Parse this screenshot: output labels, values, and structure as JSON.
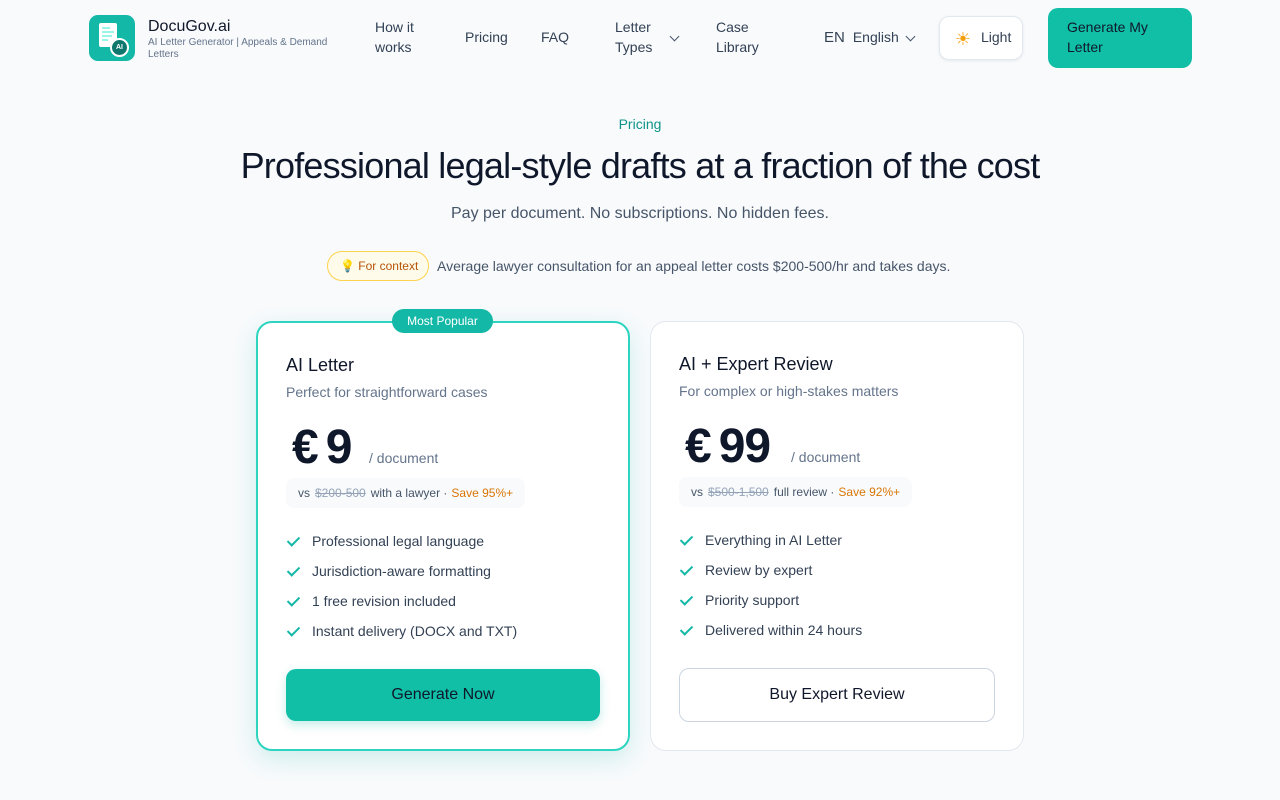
{
  "header": {
    "brand_name": "DocuGov.ai",
    "brand_tagline": "AI Letter Generator | Appeals & Demand Letters",
    "logo_badge": "AI",
    "nav": {
      "how_it_works": "How it works",
      "pricing": "Pricing",
      "faq": "FAQ",
      "letter_types": "Letter Types",
      "case_library": "Case Library"
    },
    "language": {
      "code": "EN",
      "label": "English"
    },
    "theme": {
      "icon": "sun-icon",
      "label": "Light"
    },
    "cta": "Generate My Letter"
  },
  "hero": {
    "eyebrow": "Pricing",
    "title": "Professional legal-style drafts at a fraction of the cost",
    "subtitle": "Pay per document. No subscriptions. No hidden fees.",
    "context_badge": "💡 For context",
    "context_text": "Average lawyer consultation for an appeal letter costs $200-500/hr and takes days."
  },
  "plans": [
    {
      "badge": "Most Popular",
      "name": "AI Letter",
      "description": "Perfect for straightforward cases",
      "currency": "€",
      "price": "9",
      "per": "/ document",
      "compare_vs": "vs",
      "compare_price": "$200-500",
      "compare_label": "with a lawyer ·",
      "save": "Save 95%+",
      "features": [
        "Professional legal language",
        "Jurisdiction-aware formatting",
        "1 free revision included",
        "Instant delivery (DOCX and TXT)"
      ],
      "button": "Generate Now"
    },
    {
      "name": "AI + Expert Review",
      "description": "For complex or high-stakes matters",
      "currency": "€",
      "price": "99",
      "per": "/ document",
      "compare_vs": "vs",
      "compare_price": "$500-1,500",
      "compare_label": "full review ·",
      "save": "Save 92%+",
      "features": [
        "Everything in AI Letter",
        "Review by expert",
        "Priority support",
        "Delivered within 24 hours"
      ],
      "button": "Buy Expert Review"
    }
  ],
  "colors": {
    "accent": "#14b8a6",
    "accent_button": "#10bfa6",
    "save": "#d97706",
    "background": "#f8fafc"
  }
}
